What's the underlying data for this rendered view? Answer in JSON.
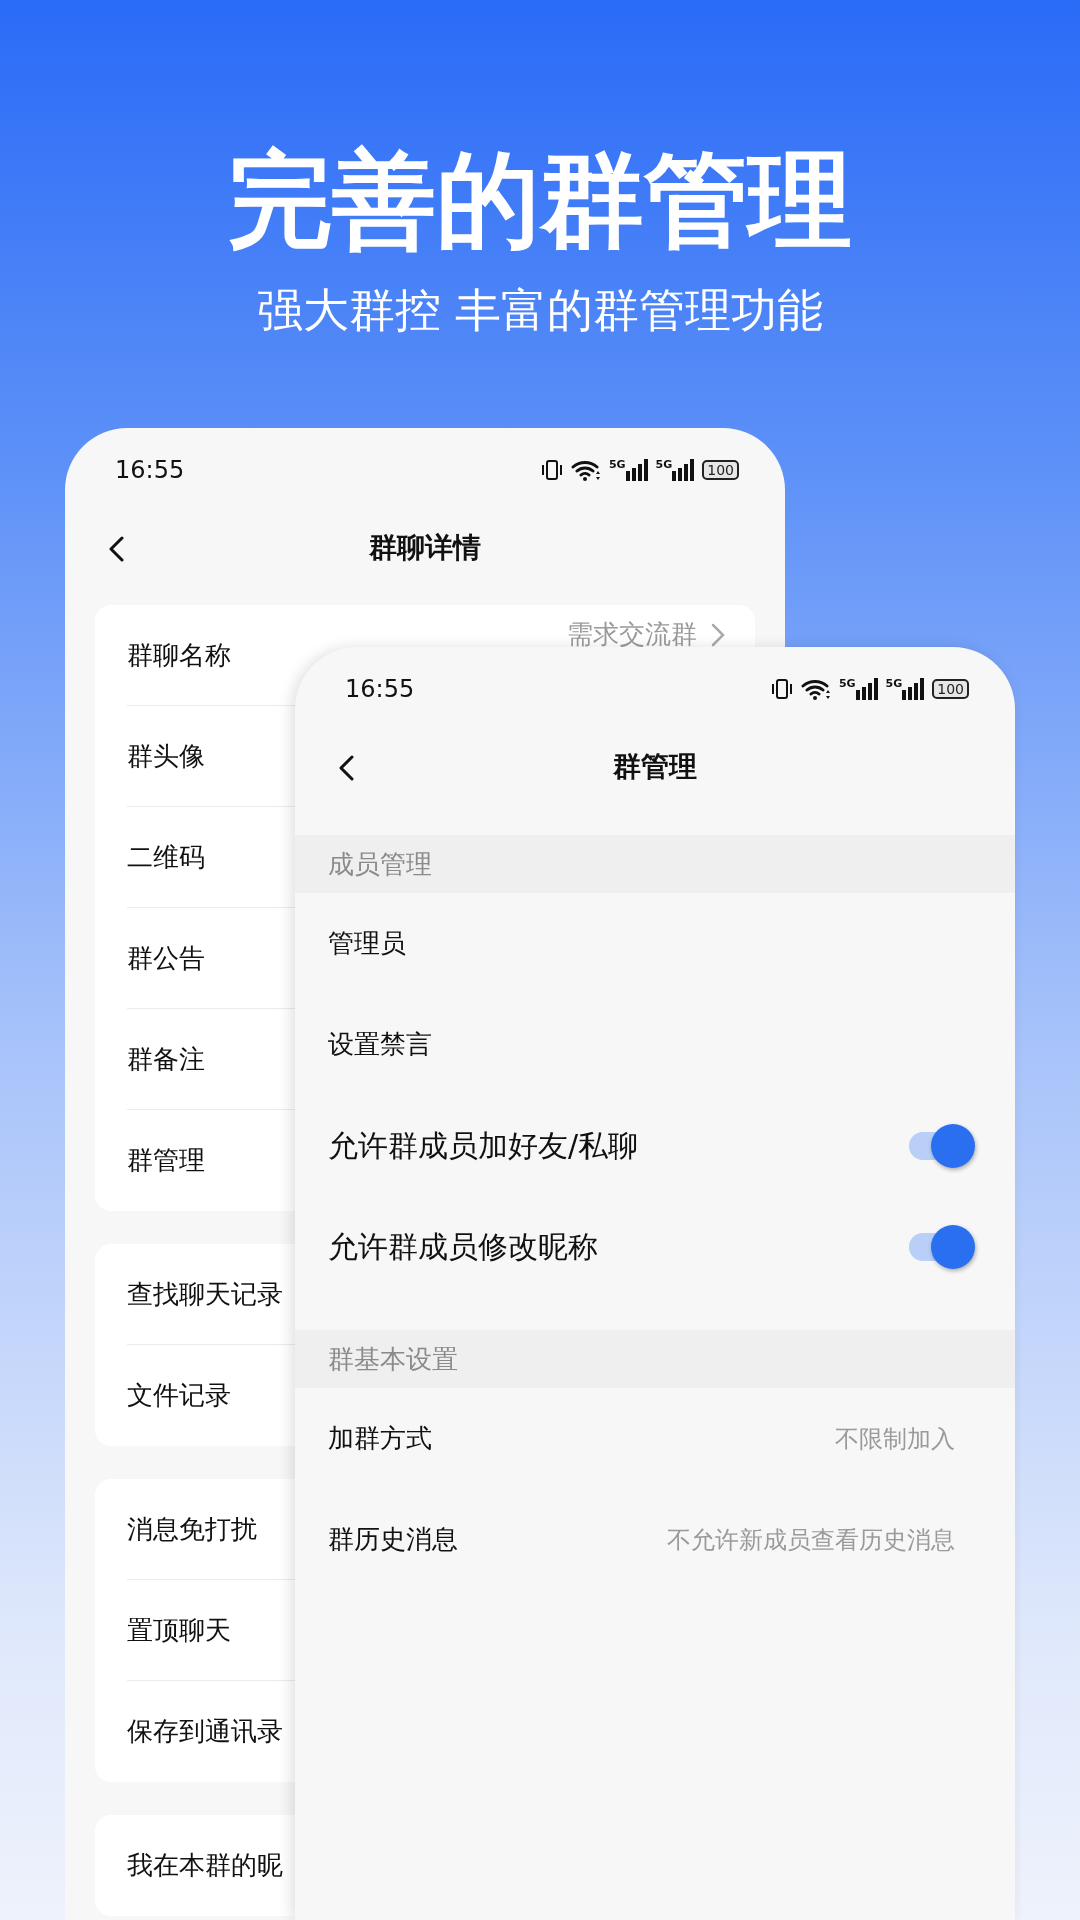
{
  "headline": {
    "title": "完善的群管理",
    "subtitle": "强大群控 丰富的群管理功能"
  },
  "back_screen": {
    "status_bar": {
      "time": "16:55",
      "network_labels": [
        "5G",
        "5G"
      ],
      "battery": "100"
    },
    "title": "群聊详情",
    "groups": [
      {
        "items": [
          {
            "label": "群聊名称",
            "value": "需求交流群"
          },
          {
            "label": "群头像"
          },
          {
            "label": "二维码"
          },
          {
            "label": "群公告"
          },
          {
            "label": "群备注"
          },
          {
            "label": "群管理"
          }
        ]
      },
      {
        "items": [
          {
            "label": "查找聊天记录"
          },
          {
            "label": "文件记录"
          }
        ]
      },
      {
        "items": [
          {
            "label": "消息免打扰"
          },
          {
            "label": "置顶聊天"
          },
          {
            "label": "保存到通讯录"
          }
        ]
      },
      {
        "items": [
          {
            "label": "我在本群的昵"
          }
        ]
      }
    ]
  },
  "front_screen": {
    "status_bar": {
      "time": "16:55",
      "network_labels": [
        "5G",
        "5G"
      ],
      "battery": "100"
    },
    "title": "群管理",
    "sections": [
      {
        "header": "成员管理",
        "items": [
          {
            "kind": "link",
            "label": "管理员"
          },
          {
            "kind": "link",
            "label": "设置禁言"
          },
          {
            "kind": "toggle",
            "label": "允许群成员加好友/私聊",
            "on": true
          },
          {
            "kind": "toggle",
            "label": "允许群成员修改昵称",
            "on": true
          }
        ]
      },
      {
        "header": "群基本设置",
        "items": [
          {
            "kind": "value",
            "label": "加群方式",
            "value": "不限制加入"
          },
          {
            "kind": "value",
            "label": "群历史消息",
            "value": "不允许新成员查看历史消息"
          }
        ]
      }
    ]
  }
}
